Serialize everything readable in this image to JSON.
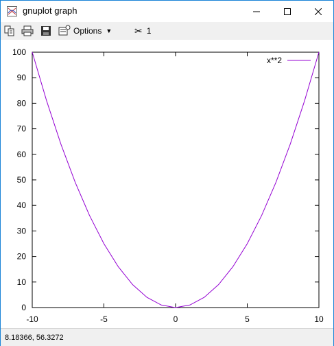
{
  "window": {
    "title": "gnuplot graph"
  },
  "toolbar": {
    "options_label": "Options",
    "scissors_label": "1",
    "icons": [
      "copy-icon",
      "print-icon",
      "save-icon",
      "options-icon",
      "scissors-icon"
    ]
  },
  "statusbar": {
    "coords": "8.18366,  56.3272"
  },
  "chart_data": {
    "type": "line",
    "function": "x**2",
    "xlim": [
      -10,
      10
    ],
    "ylim": [
      0,
      100
    ],
    "xticks": [
      -10,
      -5,
      0,
      5,
      10
    ],
    "yticks": [
      0,
      10,
      20,
      30,
      40,
      50,
      60,
      70,
      80,
      90,
      100
    ],
    "series": [
      {
        "name": "x**2",
        "color": "#9400d3",
        "x": [
          -10,
          -9,
          -8,
          -7,
          -6,
          -5,
          -4,
          -3,
          -2,
          -1,
          0,
          1,
          2,
          3,
          4,
          5,
          6,
          7,
          8,
          9,
          10
        ],
        "y": [
          100,
          81,
          64,
          49,
          36,
          25,
          16,
          9,
          4,
          1,
          0,
          1,
          4,
          9,
          16,
          25,
          36,
          49,
          64,
          81,
          100
        ]
      }
    ],
    "legend_position": "top-right",
    "grid": false
  }
}
